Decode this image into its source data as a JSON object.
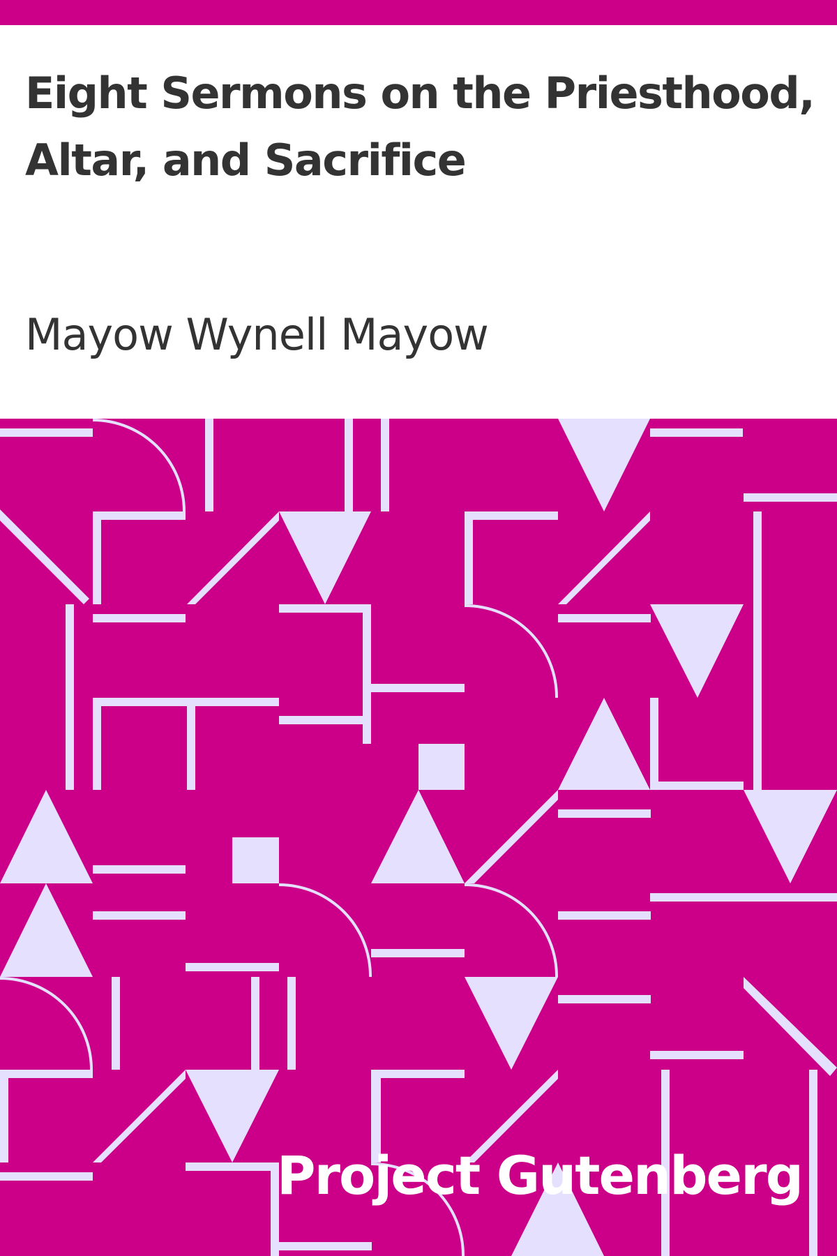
{
  "book": {
    "title": "Eight Sermons on the Priesthood, Altar, and Sacrifice",
    "author": "Mayow Wynell Mayow",
    "publisher": "Project Gutenberg"
  },
  "colors": {
    "brand": "#cc0088",
    "pattern_fg": "#e6e0ff",
    "text": "#333333",
    "publisher_text": "#ffffff"
  }
}
